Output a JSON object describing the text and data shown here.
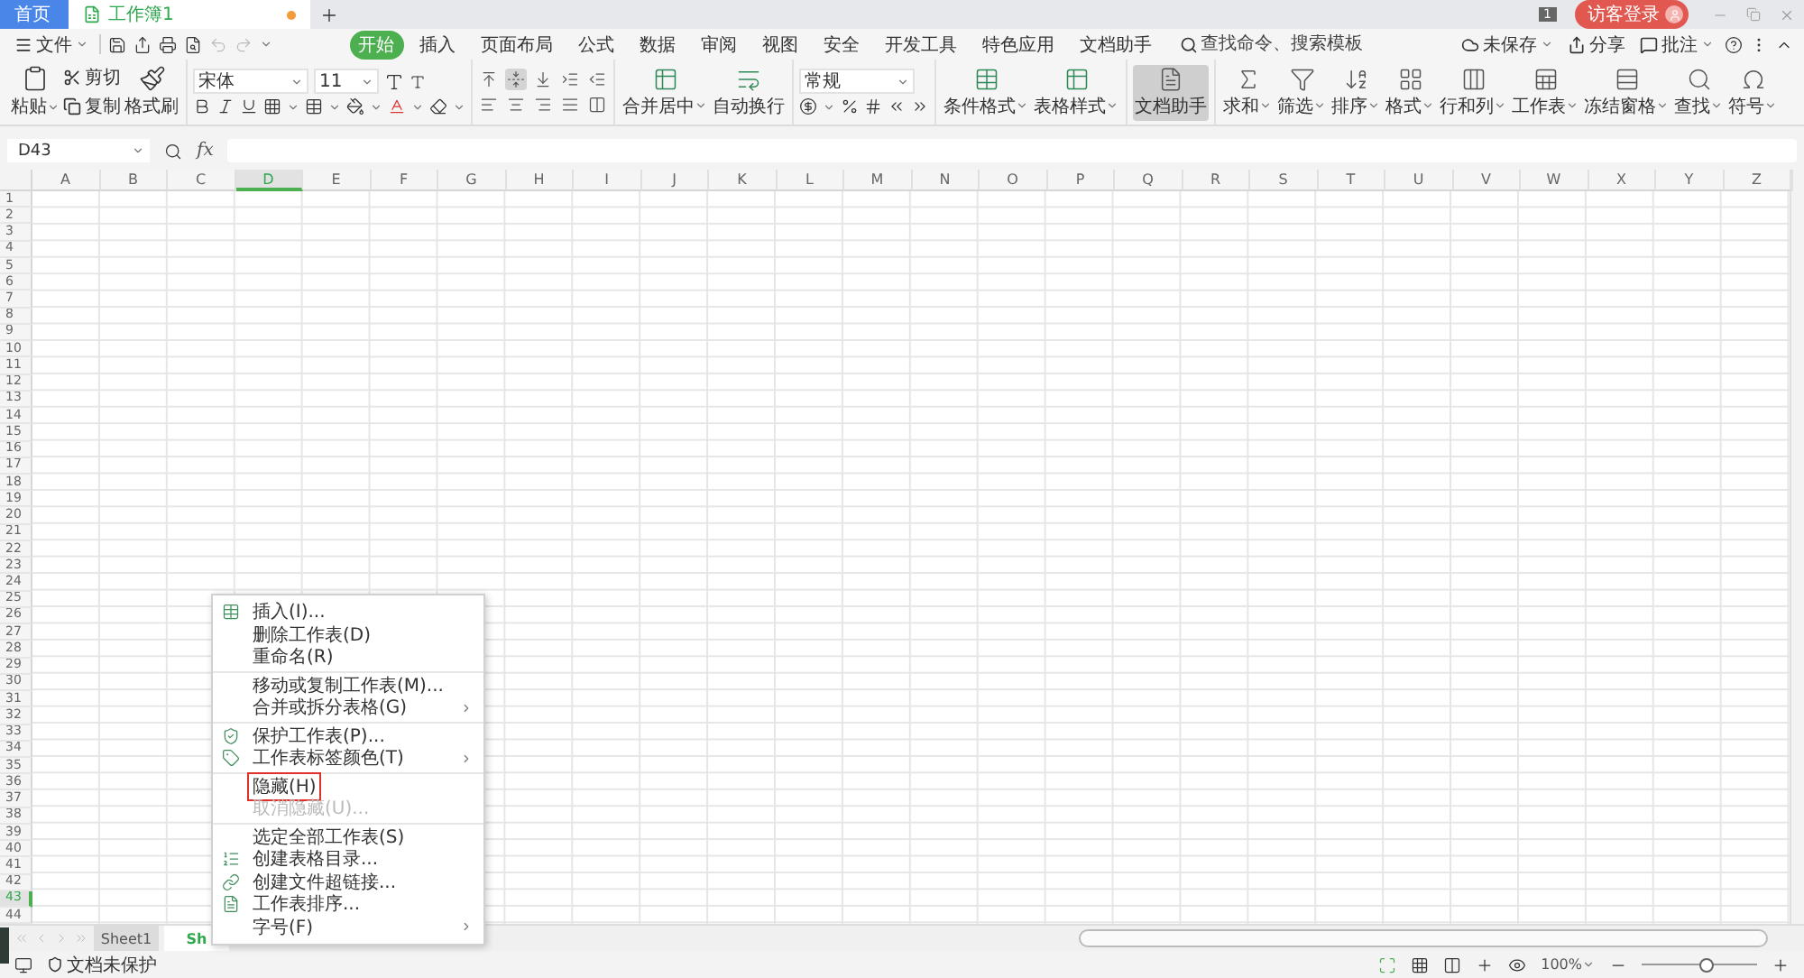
{
  "tabs": [
    {
      "label": "首页",
      "kind": "home",
      "selected": false
    },
    {
      "label": "工作簿1",
      "kind": "workbook",
      "selected": true,
      "unsaved": true
    }
  ],
  "title_bar": {
    "badge": "1",
    "login": "访客登录"
  },
  "menu_bar": {
    "file": "文件",
    "tabs": [
      {
        "label": "开始",
        "selected": true
      },
      {
        "label": "插入",
        "selected": false
      },
      {
        "label": "页面布局",
        "selected": false
      },
      {
        "label": "公式",
        "selected": false
      },
      {
        "label": "数据",
        "selected": false
      },
      {
        "label": "审阅",
        "selected": false
      },
      {
        "label": "视图",
        "selected": false
      },
      {
        "label": "安全",
        "selected": false
      },
      {
        "label": "开发工具",
        "selected": false
      },
      {
        "label": "特色应用",
        "selected": false
      },
      {
        "label": "文档助手",
        "selected": false
      }
    ],
    "search": {
      "placeholder": "查找命令、搜索模板"
    },
    "actions": [
      {
        "label": "未保存",
        "dropdown": true
      },
      {
        "label": "分享",
        "dropdown": false
      },
      {
        "label": "批注",
        "dropdown": true
      }
    ]
  },
  "ribbon": {
    "paste": {
      "label": "粘贴",
      "dropdown": true
    },
    "cut": "剪切",
    "copy": "复制",
    "format_painter": "格式刷",
    "font_name": "宋体",
    "font_size": "11",
    "align_buttons": [
      {
        "selected": false
      },
      {
        "selected": true
      },
      {
        "selected": false
      },
      {
        "selected": false
      },
      {
        "selected": false
      },
      {
        "selected": false
      },
      {
        "selected": false
      },
      {
        "selected": false
      },
      {
        "selected": false
      },
      {
        "selected": false
      }
    ],
    "merge": {
      "label": "合并居中",
      "dropdown": true
    },
    "wrap": {
      "label": "自动换行",
      "dropdown": false
    },
    "number_format": "常规",
    "tool_groups": [
      [
        {
          "label": "条件格式",
          "dropdown": true,
          "selected": false
        },
        {
          "label": "表格样式",
          "dropdown": true,
          "selected": false
        }
      ],
      [
        {
          "label": "文档助手",
          "dropdown": false,
          "selected": true
        }
      ],
      [
        {
          "label": "求和",
          "dropdown": true,
          "selected": false
        },
        {
          "label": "筛选",
          "dropdown": true,
          "selected": false
        },
        {
          "label": "排序",
          "dropdown": true,
          "selected": false
        },
        {
          "label": "格式",
          "dropdown": true,
          "selected": false
        },
        {
          "label": "行和列",
          "dropdown": true,
          "selected": false
        },
        {
          "label": "工作表",
          "dropdown": true,
          "selected": false
        },
        {
          "label": "冻结窗格",
          "dropdown": true,
          "selected": false
        },
        {
          "label": "查找",
          "dropdown": true,
          "selected": false
        },
        {
          "label": "符号",
          "dropdown": true,
          "selected": false
        }
      ]
    ]
  },
  "formula_bar": {
    "name_box": "D43",
    "fx": "fx"
  },
  "columns": [
    {
      "label": "A",
      "selected": false
    },
    {
      "label": "B",
      "selected": false
    },
    {
      "label": "C",
      "selected": false
    },
    {
      "label": "D",
      "selected": true
    },
    {
      "label": "E",
      "selected": false
    },
    {
      "label": "F",
      "selected": false
    },
    {
      "label": "G",
      "selected": false
    },
    {
      "label": "H",
      "selected": false
    },
    {
      "label": "I",
      "selected": false
    },
    {
      "label": "J",
      "selected": false
    },
    {
      "label": "K",
      "selected": false
    },
    {
      "label": "L",
      "selected": false
    },
    {
      "label": "M",
      "selected": false
    },
    {
      "label": "N",
      "selected": false
    },
    {
      "label": "O",
      "selected": false
    },
    {
      "label": "P",
      "selected": false
    },
    {
      "label": "Q",
      "selected": false
    },
    {
      "label": "R",
      "selected": false
    },
    {
      "label": "S",
      "selected": false
    },
    {
      "label": "T",
      "selected": false
    },
    {
      "label": "U",
      "selected": false
    },
    {
      "label": "V",
      "selected": false
    },
    {
      "label": "W",
      "selected": false
    },
    {
      "label": "X",
      "selected": false
    },
    {
      "label": "Y",
      "selected": false
    },
    {
      "label": "Z",
      "selected": false
    }
  ],
  "rows": [
    {
      "label": "1",
      "selected": false
    },
    {
      "label": "2",
      "selected": false
    },
    {
      "label": "3",
      "selected": false
    },
    {
      "label": "4",
      "selected": false
    },
    {
      "label": "5",
      "selected": false
    },
    {
      "label": "6",
      "selected": false
    },
    {
      "label": "7",
      "selected": false
    },
    {
      "label": "8",
      "selected": false
    },
    {
      "label": "9",
      "selected": false
    },
    {
      "label": "10",
      "selected": false
    },
    {
      "label": "11",
      "selected": false
    },
    {
      "label": "12",
      "selected": false
    },
    {
      "label": "13",
      "selected": false
    },
    {
      "label": "14",
      "selected": false
    },
    {
      "label": "15",
      "selected": false
    },
    {
      "label": "16",
      "selected": false
    },
    {
      "label": "17",
      "selected": false
    },
    {
      "label": "18",
      "selected": false
    },
    {
      "label": "19",
      "selected": false
    },
    {
      "label": "20",
      "selected": false
    },
    {
      "label": "21",
      "selected": false
    },
    {
      "label": "22",
      "selected": false
    },
    {
      "label": "23",
      "selected": false
    },
    {
      "label": "24",
      "selected": false
    },
    {
      "label": "25",
      "selected": false
    },
    {
      "label": "26",
      "selected": false
    },
    {
      "label": "27",
      "selected": false
    },
    {
      "label": "28",
      "selected": false
    },
    {
      "label": "29",
      "selected": false
    },
    {
      "label": "30",
      "selected": false
    },
    {
      "label": "31",
      "selected": false
    },
    {
      "label": "32",
      "selected": false
    },
    {
      "label": "33",
      "selected": false
    },
    {
      "label": "34",
      "selected": false
    },
    {
      "label": "35",
      "selected": false
    },
    {
      "label": "36",
      "selected": false
    },
    {
      "label": "37",
      "selected": false
    },
    {
      "label": "38",
      "selected": false
    },
    {
      "label": "39",
      "selected": false
    },
    {
      "label": "40",
      "selected": false
    },
    {
      "label": "41",
      "selected": false
    },
    {
      "label": "42",
      "selected": false
    },
    {
      "label": "43",
      "selected": true
    },
    {
      "label": "44",
      "selected": false
    }
  ],
  "context_menu": {
    "groups": [
      [
        {
          "label": "插入(I)...",
          "icon": true,
          "submenu": false,
          "disabled": false,
          "highlighted": false
        },
        {
          "label": "删除工作表(D)",
          "icon": false,
          "submenu": false,
          "disabled": false,
          "highlighted": false
        },
        {
          "label": "重命名(R)",
          "icon": false,
          "submenu": false,
          "disabled": false,
          "highlighted": false
        }
      ],
      [
        {
          "label": "移动或复制工作表(M)...",
          "icon": false,
          "submenu": false,
          "disabled": false,
          "highlighted": false
        },
        {
          "label": "合并或拆分表格(G)",
          "icon": false,
          "submenu": true,
          "disabled": false,
          "highlighted": false
        }
      ],
      [
        {
          "label": "保护工作表(P)...",
          "icon": true,
          "submenu": false,
          "disabled": false,
          "highlighted": false
        },
        {
          "label": "工作表标签颜色(T)",
          "icon": true,
          "submenu": true,
          "disabled": false,
          "highlighted": false
        }
      ],
      [
        {
          "label": "隐藏(H)",
          "icon": false,
          "submenu": false,
          "disabled": false,
          "highlighted": true
        },
        {
          "label": "取消隐藏(U)...",
          "icon": false,
          "submenu": false,
          "disabled": true,
          "highlighted": false
        }
      ],
      [
        {
          "label": "选定全部工作表(S)",
          "icon": false,
          "submenu": false,
          "disabled": false,
          "highlighted": false
        },
        {
          "label": "创建表格目录...",
          "icon": true,
          "submenu": false,
          "disabled": false,
          "highlighted": false
        },
        {
          "label": "创建文件超链接...",
          "icon": true,
          "submenu": false,
          "disabled": false,
          "highlighted": false
        },
        {
          "label": "工作表排序...",
          "icon": true,
          "submenu": false,
          "disabled": false,
          "highlighted": false
        },
        {
          "label": "字号(F)",
          "icon": false,
          "submenu": true,
          "disabled": false,
          "highlighted": false
        }
      ]
    ]
  },
  "sheet_tabs": [
    {
      "label": "Sheet1",
      "selected": false
    },
    {
      "label": "Sh",
      "selected": true
    }
  ],
  "status_bar": {
    "protection": "文档未保护",
    "zoom": "100%",
    "zoom_slider": {
      "level": 0.55
    }
  }
}
